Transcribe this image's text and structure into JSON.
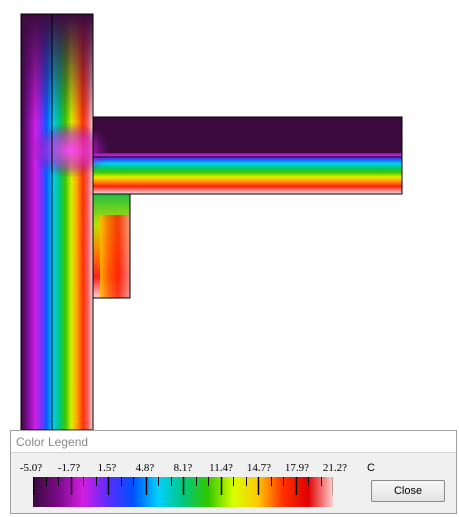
{
  "legend": {
    "title": "Color Legend",
    "unit": "C",
    "close_label": "Close",
    "tick_labels": [
      "-5.0?",
      "-1.7?",
      "1.5?",
      "4.8?",
      "8.1?",
      "11.4?",
      "14.7?",
      "17.9?",
      "21.2?"
    ],
    "range": [
      -5.0,
      21.2
    ],
    "colors": [
      "#3a0a3e",
      "#7a0a86",
      "#d21ee0",
      "#5a2cff",
      "#0050ff",
      "#00d0ff",
      "#00c880",
      "#30c800",
      "#d8ff00",
      "#ffc800",
      "#ff3000",
      "#e00000",
      "#ffd0d0"
    ]
  }
}
